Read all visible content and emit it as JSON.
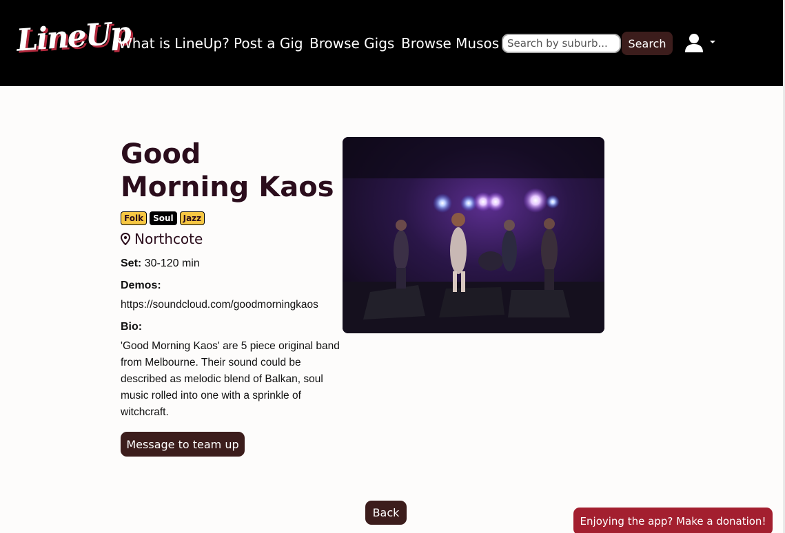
{
  "nav": {
    "logo": "LineUp",
    "links": [
      "What is LineUp?",
      "Post a Gig",
      "Browse Gigs",
      "Browse Musos"
    ],
    "search_placeholder": "Search by suburb...",
    "search_button": "Search",
    "user_icon": "user-icon"
  },
  "musician": {
    "name": "Good Morning Kaos",
    "genres": [
      "Folk",
      "Soul",
      "Jazz"
    ],
    "location": "Northcote",
    "set_label": "Set:",
    "set_value": "30-120 min",
    "demos_label": "Demos:",
    "demos_link": "https://soundcloud.com/goodmorningkaos",
    "bio_label": "Bio:",
    "bio": "'Good Morning Kaos' are 5 piece original band from Melbourne. Their sound could be described as melodic blend of Balkan, soul music rolled into one with a sprinkle of witchcraft."
  },
  "actions": {
    "message": "Message to team up",
    "back": "Back",
    "donation": "Enjoying the app? Make a donation!"
  },
  "colors": {
    "brand_dark": "#3c1d1c",
    "donation_red": "#a31f2f",
    "badge_yellow": "#f6c743",
    "nav_bg": "#000000"
  }
}
